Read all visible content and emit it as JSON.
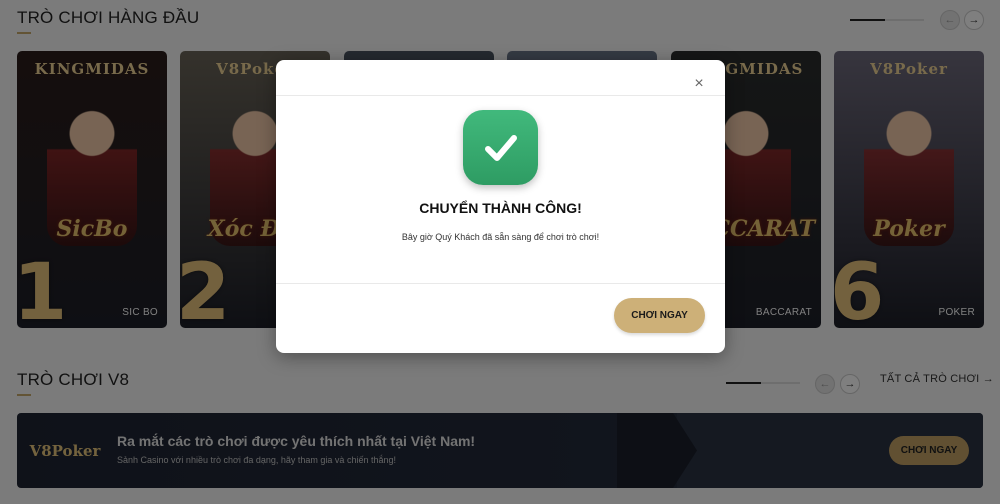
{
  "section_top": {
    "title": "TRÒ CHƠI HÀNG ĐẦU",
    "prev_icon": "arrow-left-icon",
    "next_icon": "arrow-right-icon"
  },
  "cards": [
    {
      "brand": "KINGMIDAS",
      "logo": "SicBo",
      "rank": "1",
      "name": "SIC BO",
      "bg": "#2b1d1a"
    },
    {
      "brand": "V8Poker",
      "logo": "Xóc Đĩa",
      "rank": "2",
      "name": "",
      "bg": "#6a6458"
    },
    {
      "brand": "",
      "logo": "",
      "rank": "",
      "name": "",
      "bg": "#4a5360"
    },
    {
      "brand": "",
      "logo": "",
      "rank": "",
      "name": "",
      "bg": "#6a7588"
    },
    {
      "brand": "KINGMIDAS",
      "logo": "BACCARAT",
      "rank": "",
      "name": "BACCARAT",
      "bg": "#2b2d2c"
    },
    {
      "brand": "V8Poker",
      "logo": "Poker",
      "rank": "6",
      "name": "POKER",
      "bg": "#6e6a7c"
    }
  ],
  "section_v8": {
    "title": "TRÒ CHƠI V8",
    "all_link": "TẤT CẢ TRÒ CHƠI",
    "all_link_icon": "arrow-right-icon"
  },
  "banner": {
    "logo": "V8Poker",
    "title": "Ra mắt các trò chơi được yêu thích nhất tại Việt Nam!",
    "subtitle": "Sảnh Casino với nhiều trò chơi đa dạng, hãy tham gia và chiến thắng!",
    "button": "CHƠI NGAY"
  },
  "modal": {
    "close_icon": "close-icon",
    "success_icon": "check-icon",
    "title": "CHUYỂN THÀNH CÔNG!",
    "message": "Bây giờ Quý Khách đã sẵn sàng để chơi trò chơi!",
    "button": "CHƠI NGAY"
  },
  "colors": {
    "accent_gold": "#cdb078",
    "success_green": "#3aae73",
    "overlay": "rgba(0,0,0,0.5)"
  }
}
